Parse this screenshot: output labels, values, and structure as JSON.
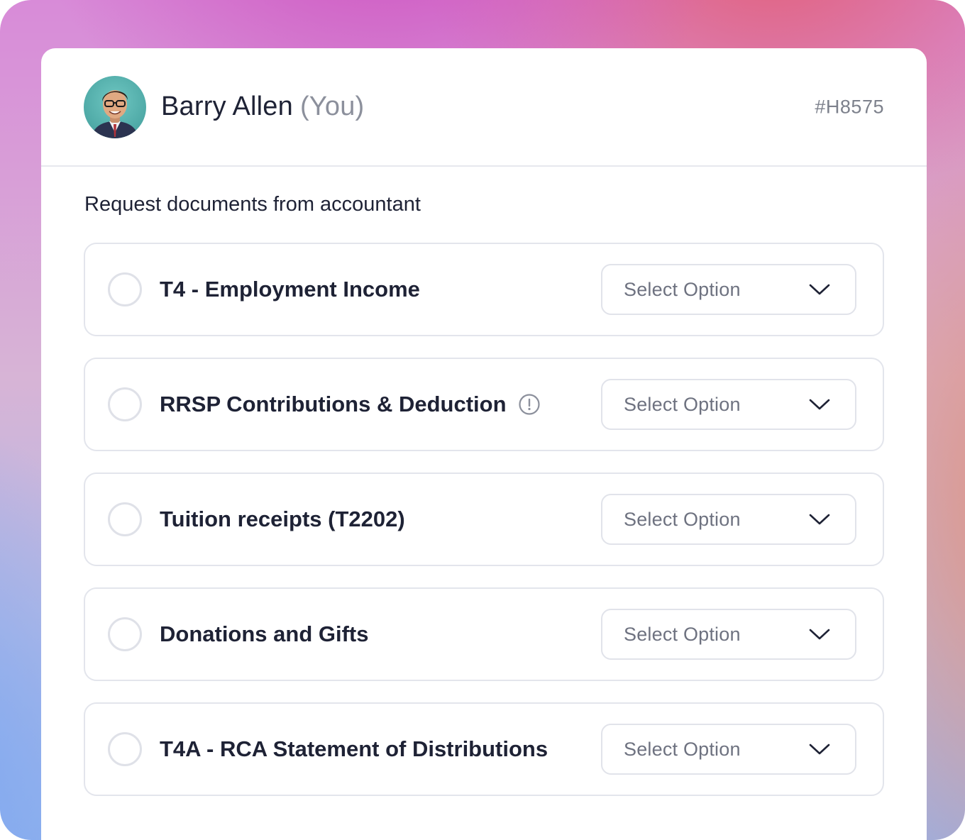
{
  "user": {
    "name": "Barry Allen",
    "you_label": "(You)",
    "avatar_icon": "avatar-portrait"
  },
  "ticket_id": "#H8575",
  "section_title": "Request documents from accountant",
  "documents": [
    {
      "label": "T4 - Employment Income",
      "selected": false,
      "select_placeholder": "Select Option",
      "has_info_icon": false
    },
    {
      "label": "RRSP Contributions & Deduction",
      "selected": false,
      "select_placeholder": "Select Option",
      "has_info_icon": true
    },
    {
      "label": "Tuition receipts (T2202)",
      "selected": false,
      "select_placeholder": "Select Option",
      "has_info_icon": false
    },
    {
      "label": "Donations and Gifts",
      "selected": false,
      "select_placeholder": "Select Option",
      "has_info_icon": false
    },
    {
      "label": "T4A - RCA Statement of Distributions",
      "selected": false,
      "select_placeholder": "Select Option",
      "has_info_icon": false
    }
  ],
  "icons": {
    "info": "info-circle-icon",
    "dropdown": "chevron-down-icon"
  },
  "colors": {
    "text_primary": "#1e2235",
    "text_muted": "#8c909c",
    "border": "#e3e5ec",
    "card_bg": "#ffffff"
  }
}
